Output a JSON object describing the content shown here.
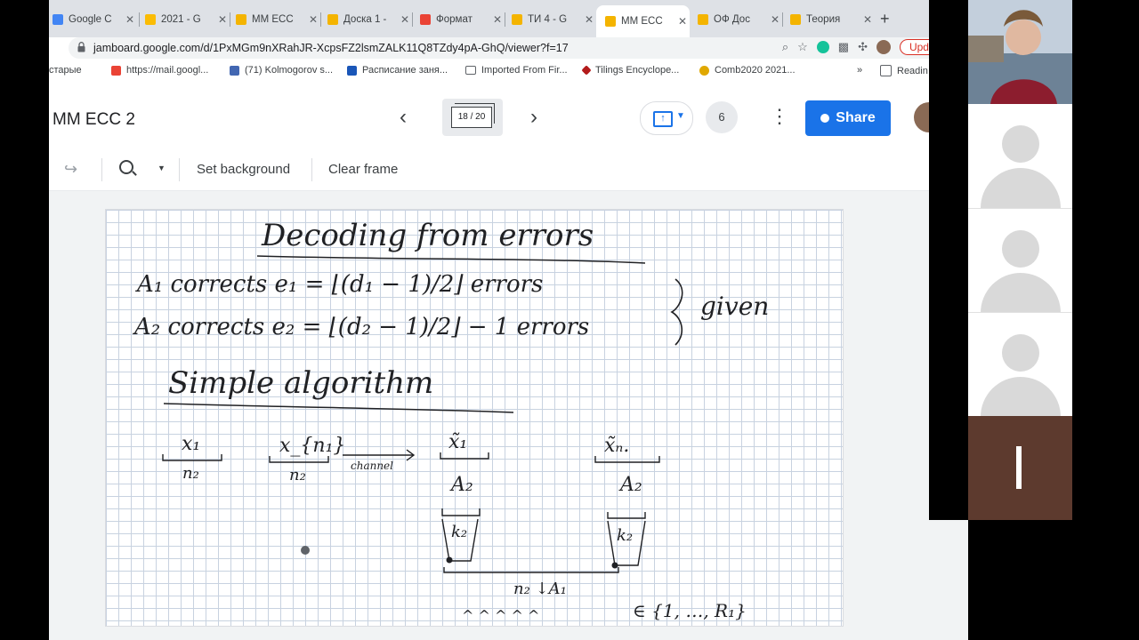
{
  "browser": {
    "tabs": [
      {
        "title": "Google C",
        "color": "#4285f4",
        "active": false
      },
      {
        "title": "2021 - G",
        "color": "#fbbc04",
        "active": false
      },
      {
        "title": "ММ ЕСС",
        "color": "#f4b400",
        "active": false
      },
      {
        "title": "Доска 1 -",
        "color": "#f4b400",
        "active": false
      },
      {
        "title": "Формат",
        "color": "#ea4335",
        "active": false
      },
      {
        "title": "ТИ 4 - G",
        "color": "#f4b400",
        "active": false
      },
      {
        "title": "ММ ЕСС",
        "color": "#f4b400",
        "active": true
      },
      {
        "title": "ОФ Дос",
        "color": "#f4b400",
        "active": false
      },
      {
        "title": "Теория",
        "color": "#f4b400",
        "active": false
      }
    ],
    "new_tab": "+",
    "url": "jamboard.google.com/d/1PxMGm9nXRahJR-XcpsFZ2lsmZALK11Q8TZdy4pA-GhQ/viewer?f=17",
    "update_label": "Updat",
    "bookmarks": [
      {
        "label": "старые",
        "color": "#5f6368"
      },
      {
        "label": "https://mail.googl...",
        "color": "#ea4335"
      },
      {
        "label": "(71) Kolmogorov s...",
        "color": "#4267b2"
      },
      {
        "label": "Расписание заня...",
        "color": "#1a56b8"
      },
      {
        "label": "Imported From Fir...",
        "color": "#5f6368"
      },
      {
        "label": "Tilings Encyclope...",
        "color": "#b31b1b"
      },
      {
        "label": "Comb2020 2021...",
        "color": "#e0a800"
      }
    ],
    "bookmarks_more": "»",
    "reading_list": "Readin"
  },
  "jamboard": {
    "title": "ММ ЕСС 2",
    "frame_indicator": "18 / 20",
    "collaborators_count": "6",
    "share_label": "Share",
    "toolbar": {
      "set_background": "Set background",
      "clear_frame": "Clear frame"
    }
  },
  "board_ink": {
    "heading": "Decoding from errors",
    "line_a1": "A₁ corrects e₁ = ⌊(d₁ − 1)/2⌋ errors",
    "line_a2": "A₂ corrects e₂ = ⌊(d₂ − 1)/2⌋ − 1 errors",
    "given": "given",
    "subheading": "Simple algorithm",
    "x1": "x₁",
    "x1_len": "n₂",
    "xn1": "x_{n₁}",
    "xn1_len": "n₂",
    "channel": "channel",
    "x1_tilde": "x̃₁",
    "xn_tilde": "x̃ₙ.",
    "a2": "A₂",
    "k2": "k₂",
    "n2_a1": "n₂ ↓A₁",
    "set_label": "∈ {1, …, R₁}"
  },
  "participants": [
    {
      "type": "video"
    },
    {
      "type": "avatar"
    },
    {
      "type": "avatar"
    },
    {
      "type": "avatar"
    },
    {
      "type": "screen"
    }
  ]
}
